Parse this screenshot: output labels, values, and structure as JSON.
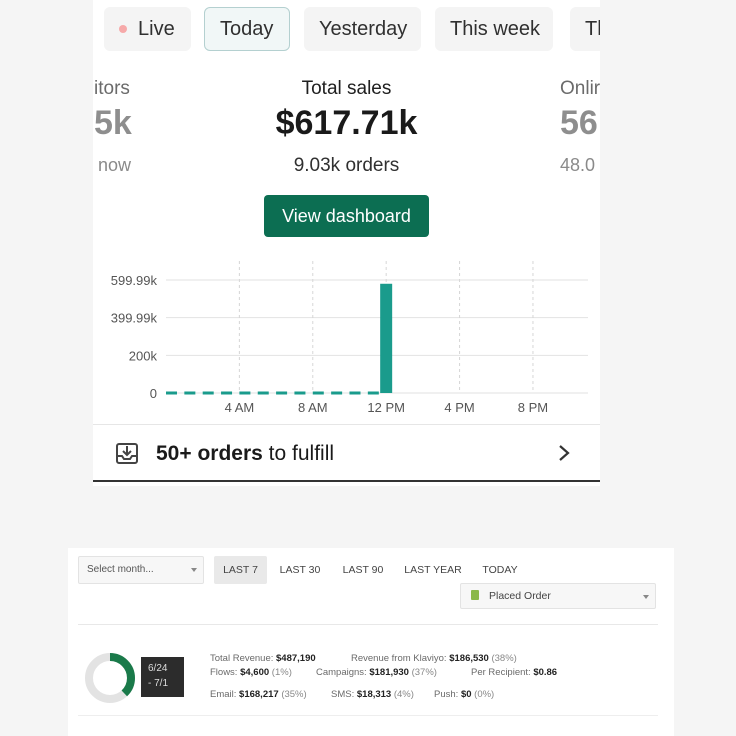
{
  "shopify": {
    "tabs": [
      {
        "label": "Live"
      },
      {
        "label": "Today"
      },
      {
        "label": "Yesterday"
      },
      {
        "label": "This week"
      },
      {
        "label": "Th"
      }
    ],
    "left_stat": {
      "label": "itors",
      "value": "5k",
      "sub": "now"
    },
    "center_stat": {
      "label": "Total sales",
      "value": "$617.71k",
      "sub": "9.03k orders"
    },
    "right_stat": {
      "label": "Onlir",
      "value": "56",
      "sub": "48.0"
    },
    "view_button": "View dashboard",
    "fulfill": {
      "count": "50+ orders",
      "rest": "to fulfill"
    },
    "colors": {
      "accent": "#0c6e52",
      "bar": "#1a9b8c",
      "live_dot": "#f6a9a9"
    },
    "icons": {
      "fulfill": "download-icon",
      "chevron": "chevron-right-icon"
    }
  },
  "chart_data": {
    "type": "bar",
    "categories": [
      "0",
      "1",
      "2",
      "3",
      "4",
      "5",
      "6",
      "7",
      "8",
      "9",
      "10",
      "11",
      "12"
    ],
    "x_ticks": [
      "4 AM",
      "8 AM",
      "12 PM",
      "4 PM",
      "8 PM"
    ],
    "y_ticks": [
      "599.99k",
      "399.99k",
      "200k",
      "0"
    ],
    "values": [
      0,
      0,
      0,
      0,
      0,
      0,
      0,
      0,
      0,
      0,
      0,
      0,
      580000
    ],
    "ylim": [
      0,
      599990
    ],
    "grid": true
  },
  "klaviyo": {
    "month_select": "Select month...",
    "ranges": [
      {
        "label": "LAST 7",
        "active": true
      },
      {
        "label": "LAST 30",
        "active": false
      },
      {
        "label": "LAST 90",
        "active": false
      },
      {
        "label": "LAST YEAR",
        "active": false
      },
      {
        "label": "TODAY",
        "active": false
      }
    ],
    "metric": "Placed Order",
    "date_range": {
      "line1": "6/24",
      "line2": "- 7/1"
    },
    "donut_fraction": 0.38,
    "stats": {
      "total_revenue_label": "Total Revenue:",
      "total_revenue": "$487,190",
      "klaviyo_label": "Revenue from Klaviyo:",
      "klaviyo": "$186,530",
      "klaviyo_pct": "(38%)",
      "flows_label": "Flows:",
      "flows": "$4,600",
      "flows_pct": "(1%)",
      "campaigns_label": "Campaigns:",
      "campaigns": "$181,930",
      "campaigns_pct": "(37%)",
      "per_recipient_label": "Per Recipient:",
      "per_recipient": "$0.86",
      "email_label": "Email:",
      "email": "$168,217",
      "email_pct": "(35%)",
      "sms_label": "SMS:",
      "sms": "$18,313",
      "sms_pct": "(4%)",
      "push_label": "Push:",
      "push": "$0",
      "push_pct": "(0%)"
    },
    "colors": {
      "donut_fill": "#1a7a4a",
      "donut_track": "#e3e3e3"
    }
  }
}
